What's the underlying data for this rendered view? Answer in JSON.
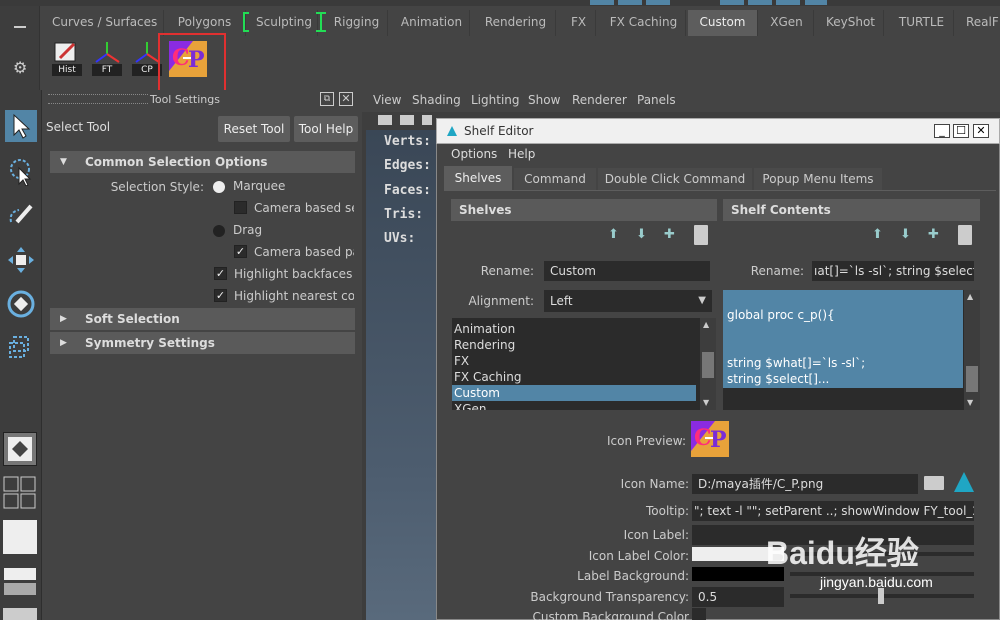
{
  "shelf_tabs": [
    "Curves / Surfaces",
    "Polygons",
    "Sculpting",
    "Rigging",
    "Animation",
    "Rendering",
    "FX",
    "FX Caching",
    "Custom",
    "XGen",
    "KeyShot",
    "TURTLE",
    "RealF"
  ],
  "active_tab": "Custom",
  "shelf_buttons": [
    {
      "label": "Hist",
      "icon": "history-icon"
    },
    {
      "label": "FT",
      "icon": "axes-icon"
    },
    {
      "label": "CP",
      "icon": "axes-icon"
    },
    {
      "label": "",
      "icon": "cp-custom-icon"
    }
  ],
  "tool_settings": {
    "title": "Tool Settings",
    "tool_name": "Select Tool",
    "reset_label": "Reset Tool",
    "help_label": "Tool Help",
    "common_selection": "Common Selection Options",
    "selection_style_label": "Selection Style:",
    "marquee": "Marquee",
    "camera_based_sel": "Camera based sel",
    "drag": "Drag",
    "camera_based_pai": "Camera based pai",
    "highlight_backfaces": "Highlight backfaces",
    "highlight_nearest": "Highlight nearest com",
    "soft_selection": "Soft Selection",
    "symmetry_settings": "Symmetry Settings"
  },
  "viewport": {
    "menu": [
      "View",
      "Shading",
      "Lighting",
      "Show",
      "Renderer",
      "Panels"
    ],
    "hud": [
      "Verts:",
      "Edges:",
      "Faces:",
      "Tris:",
      "UVs:"
    ]
  },
  "shelf_editor": {
    "title": "Shelf Editor",
    "menu": [
      "Options",
      "Help"
    ],
    "tabs": [
      "Shelves",
      "Command",
      "Double Click Command",
      "Popup Menu Items"
    ],
    "active_tab": "Shelves",
    "shelves_header": "Shelves",
    "contents_header": "Shelf Contents",
    "rename_label": "Rename:",
    "rename_value": "Custom",
    "rename2_value": "ıat[]=`ls -sl`; string $select[]...",
    "alignment_label": "Alignment:",
    "alignment_value": "Left",
    "shelf_list": [
      "Animation",
      "Rendering",
      "FX",
      "FX Caching",
      "Custom",
      "XGen"
    ],
    "selected_shelf": "Custom",
    "code_lines": [
      "global proc  c_p(){",
      "string $what[]=`ls -sl`;",
      "string $select[]..."
    ],
    "icon_preview_label": "Icon Preview:",
    "icon_name_label": "Icon Name:",
    "icon_name_value": "D:/maya插件/C_P.png",
    "tooltip_label": "Tooltip:",
    "tooltip_value": "\"; text -l \"\"; setParent ..;     showWindow FY_tool_22;",
    "icon_label_label": "Icon Label:",
    "icon_label_color_label": "Icon Label Color:",
    "label_background_label": "Label Background:",
    "bg_transparency_label": "Background Transparency:",
    "bg_transparency_value": "0.5",
    "custom_bg_color_label": "Custom Background Color"
  },
  "watermark": {
    "text": "Baidu经验",
    "url": "jingyan.baidu.com"
  },
  "colors": {
    "accent": "#5285a6",
    "highlight_box": "#e03030",
    "bracket": "#22dd55"
  }
}
